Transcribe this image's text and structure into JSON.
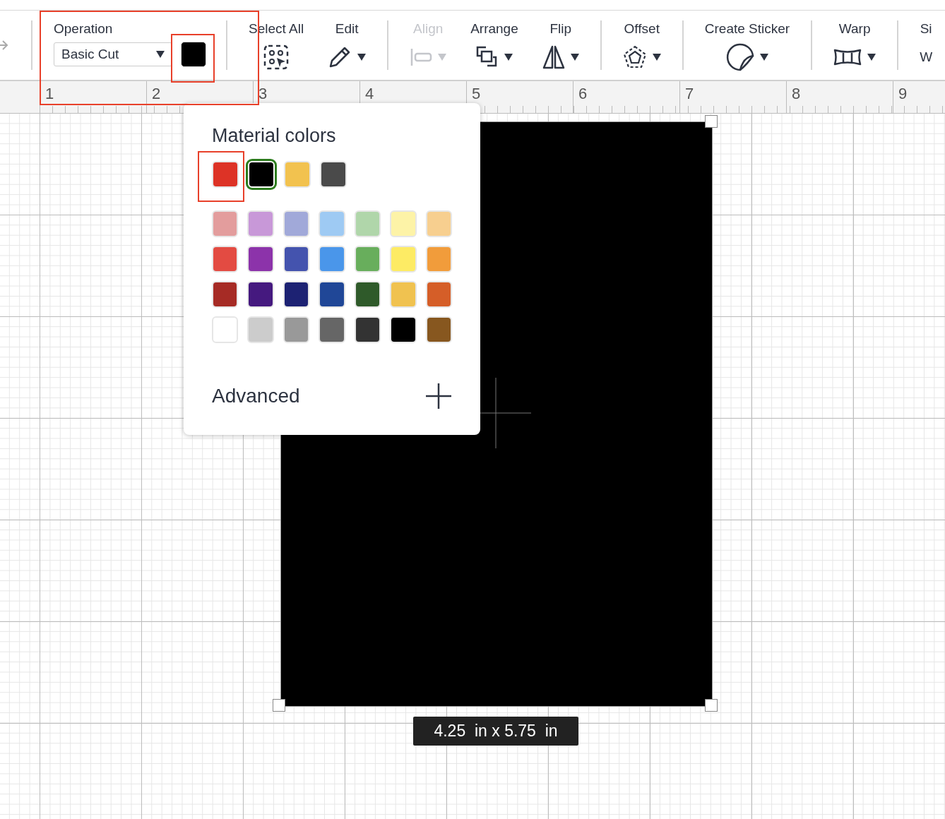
{
  "operation": {
    "label": "Operation",
    "value": "Basic Cut",
    "color": "#000000"
  },
  "tool_groups": [
    {
      "tools": [
        {
          "label": "Select All",
          "kind": "select-all",
          "dropdown": false,
          "disabled": false
        },
        {
          "label": "Edit",
          "kind": "pencil",
          "dropdown": true,
          "disabled": false
        }
      ]
    },
    {
      "tools": [
        {
          "label": "Align",
          "kind": "align",
          "dropdown": true,
          "disabled": true
        },
        {
          "label": "Arrange",
          "kind": "arrange",
          "dropdown": true,
          "disabled": false
        },
        {
          "label": "Flip",
          "kind": "flip",
          "dropdown": true,
          "disabled": false
        }
      ]
    },
    {
      "tools": [
        {
          "label": "Offset",
          "kind": "offset",
          "dropdown": true,
          "disabled": false
        }
      ]
    },
    {
      "tools": [
        {
          "label": "Create Sticker",
          "kind": "sticker",
          "dropdown": true,
          "disabled": false
        }
      ]
    },
    {
      "tools": [
        {
          "label": "Warp",
          "kind": "warp",
          "dropdown": true,
          "disabled": false
        }
      ]
    },
    {
      "tools": [
        {
          "label": "Si",
          "kind": "text",
          "value": "W",
          "disabled": false
        }
      ]
    }
  ],
  "ruler": {
    "numbers": [
      "1",
      "2",
      "3",
      "4",
      "5",
      "6",
      "7",
      "8",
      "9"
    ]
  },
  "color_popup": {
    "title": "Material colors",
    "recent": [
      {
        "color": "#dd3326",
        "selected": false
      },
      {
        "color": "#000000",
        "selected": true
      },
      {
        "color": "#f2c24f",
        "selected": false
      },
      {
        "color": "#4a4a4a",
        "selected": false
      }
    ],
    "palette": [
      [
        {
          "color": "#e39d9d",
          "selected": false
        },
        {
          "color": "#c898d8",
          "selected": false
        },
        {
          "color": "#a1a9d9",
          "selected": false
        },
        {
          "color": "#9ecaf3",
          "selected": false
        },
        {
          "color": "#b0d6aa",
          "selected": false
        },
        {
          "color": "#fdf3a7",
          "selected": false
        },
        {
          "color": "#f7cf8f",
          "selected": false
        }
      ],
      [
        {
          "color": "#e34b42",
          "selected": false
        },
        {
          "color": "#8c33aa",
          "selected": false
        },
        {
          "color": "#4453ae",
          "selected": false
        },
        {
          "color": "#4a96ea",
          "selected": false
        },
        {
          "color": "#68ae5c",
          "selected": false
        },
        {
          "color": "#fdeb64",
          "selected": false
        },
        {
          "color": "#f19c3b",
          "selected": false
        }
      ],
      [
        {
          "color": "#a62b25",
          "selected": false
        },
        {
          "color": "#45197f",
          "selected": false
        },
        {
          "color": "#1d2273",
          "selected": false
        },
        {
          "color": "#204797",
          "selected": false
        },
        {
          "color": "#2f5a2a",
          "selected": false
        },
        {
          "color": "#f0c250",
          "selected": false
        },
        {
          "color": "#d55e28",
          "selected": false
        }
      ],
      [
        {
          "color": "#ffffff",
          "selected": false
        },
        {
          "color": "#cccccc",
          "selected": false
        },
        {
          "color": "#999999",
          "selected": false
        },
        {
          "color": "#666666",
          "selected": false
        },
        {
          "color": "#333333",
          "selected": false
        },
        {
          "color": "#000000",
          "selected": false
        },
        {
          "color": "#87571f",
          "selected": false
        }
      ]
    ],
    "advanced": "Advanced"
  },
  "selection": {
    "color": "#000000",
    "size": "4.25  in x 5.75  in"
  },
  "annotations": [
    {
      "kind": "operation-group"
    },
    {
      "kind": "color-chip"
    },
    {
      "kind": "swatch"
    }
  ]
}
